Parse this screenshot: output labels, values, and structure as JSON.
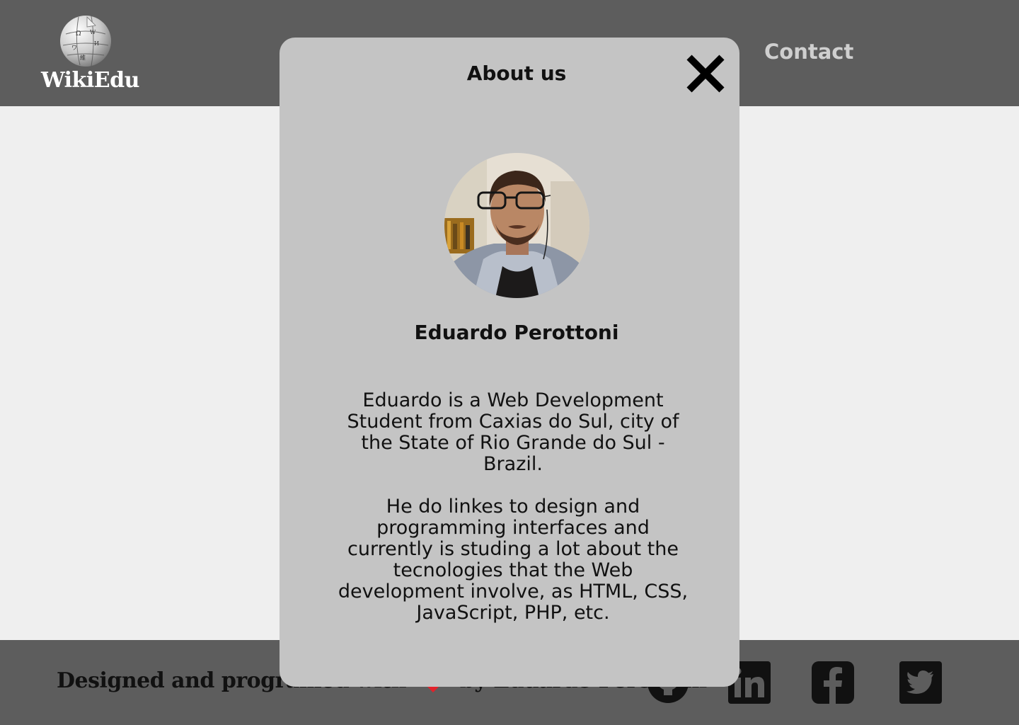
{
  "header": {
    "logo_text": "WikiEdu",
    "nav": {
      "contact_label": "Contact"
    }
  },
  "modal": {
    "title": "About us",
    "person_name": "Eduardo Perottoni",
    "bio_paragraph_1": "Eduardo is a Web Development Student from Caxias do Sul, city of the State of Rio Grande do Sul - Brazil.",
    "bio_paragraph_2": "He do linkes to design and programming interfaces and currently is studing a lot about the tecnologies that the Web development involve, as HTML, CSS, JavaScript, PHP, etc."
  },
  "footer": {
    "credit_before": "Designed and programed with",
    "credit_after": "by Eduardo Perottoni",
    "social": [
      "github-icon",
      "linkedin-icon",
      "facebook-icon",
      "twitter-icon"
    ]
  },
  "colors": {
    "header_bg": "#5d5d5d",
    "page_bg": "#efefef",
    "modal_bg": "#c4c4c4",
    "nav_text": "#cfcfcf",
    "heart": "#e3222b"
  }
}
